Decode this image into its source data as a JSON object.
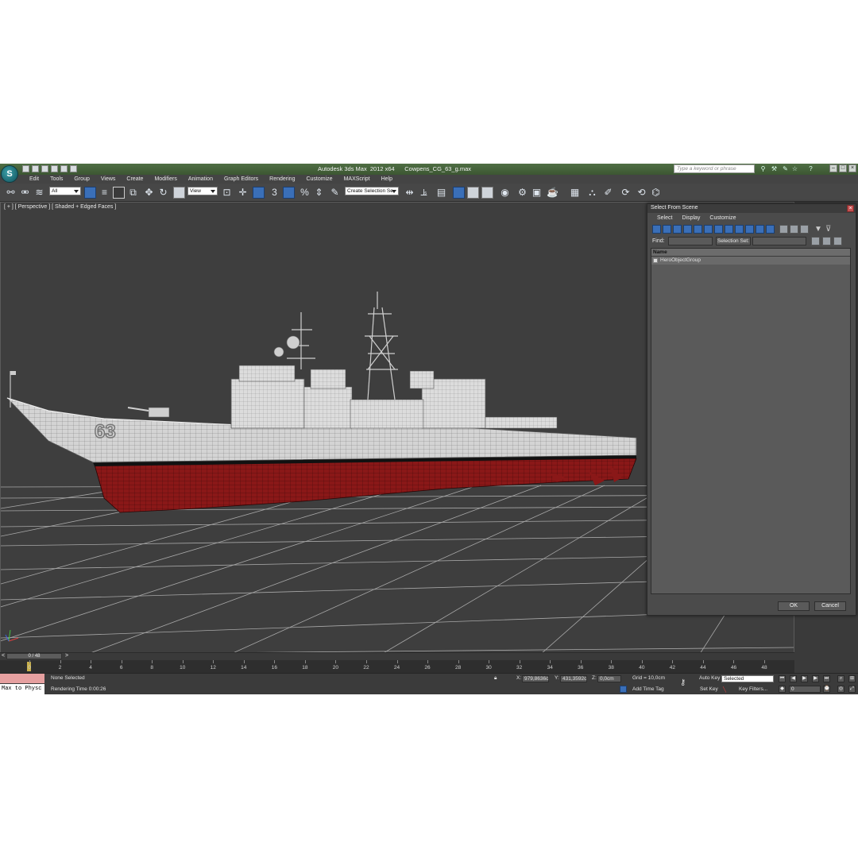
{
  "window": {
    "title": "Autodesk 3ds Max  2012 x64      Cowpens_CG_63_g.max",
    "search_placeholder": "Type a keyword or phrase",
    "logo_text": "S"
  },
  "menu": [
    "Edit",
    "Tools",
    "Group",
    "Views",
    "Create",
    "Modifiers",
    "Animation",
    "Graph Editors",
    "Rendering",
    "Customize",
    "MAXScript",
    "Help"
  ],
  "toolbar": {
    "selection_filter": "All",
    "reference_coord": "View",
    "named_selection_placeholder": "Create Selection Se"
  },
  "viewport": {
    "label": "[ + ] [ Perspective ] [ Shaded + Edged Faces ]",
    "hull_number": "63",
    "colors": {
      "background": "#3e3e3e",
      "grid": "#9a9a9a",
      "hull": "#d9d9d9",
      "waterline": "#8b1a1a"
    }
  },
  "dialog": {
    "title": "Select From Scene",
    "menu": [
      "Select",
      "Display",
      "Customize"
    ],
    "find_label": "Find:",
    "selection_set_label": "Selection Set:",
    "column_header": "Name",
    "rows": [
      "HeroObjectGroup"
    ],
    "ok_label": "OK",
    "cancel_label": "Cancel"
  },
  "timeline": {
    "frame_display": "0 / 48",
    "prev": "<",
    "next": ">",
    "ticks": [
      "0",
      "2",
      "4",
      "6",
      "8",
      "10",
      "12",
      "14",
      "16",
      "18",
      "20",
      "22",
      "24",
      "26",
      "28",
      "30",
      "32",
      "34",
      "36",
      "38",
      "40",
      "42",
      "44",
      "46",
      "48"
    ]
  },
  "status": {
    "maxscript_listener": "Max to Physc",
    "selection": "None Selected",
    "rendering_time": "Rendering Time  0:00:26",
    "x_label": "X:",
    "x_value": "979,8636c",
    "y_label": "Y:",
    "y_value": "431,3592c",
    "z_label": "Z:",
    "z_value": "0,0cm",
    "grid": "Grid = 10,0cm",
    "add_time_tag": "Add Time Tag",
    "auto_key": "Auto Key",
    "auto_key_value": "Selected",
    "set_key": "Set Key",
    "key_filters": "Key Filters...",
    "current_frame": "0"
  }
}
